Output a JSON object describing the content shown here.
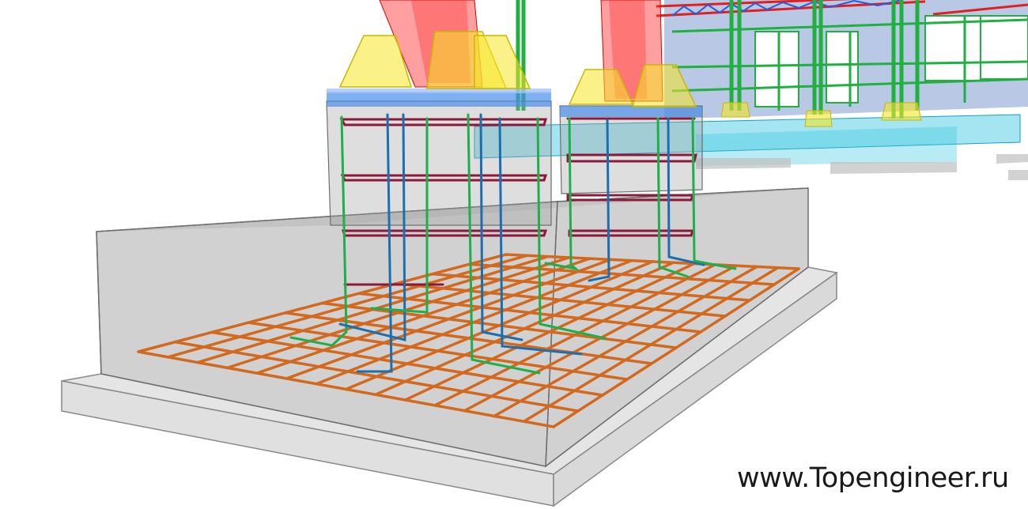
{
  "watermark": {
    "text": "www.Topengineer.ru"
  },
  "colors": {
    "concrete_fill": "#9a9a9a",
    "concrete_edge": "#6f6f6f",
    "rebar_mesh": "#d2691e",
    "rebar_stirrup": "#8b1a3a",
    "rebar_vertical_green": "#1fae4c",
    "rebar_vertical_blue": "#1a6fb0",
    "steel_column": "#ff2a2a",
    "base_plate": "#f5e628",
    "steel_frame_green": "#20b040",
    "steel_truss_red": "#e02020",
    "steel_truss_blue": "#2a5bd8",
    "wall_panel": "#7f9bd0",
    "ground_beam": "#36c6e0"
  },
  "icons": [
    "steel-column-icon",
    "rebar-cage-icon",
    "foundation-slab-icon"
  ]
}
